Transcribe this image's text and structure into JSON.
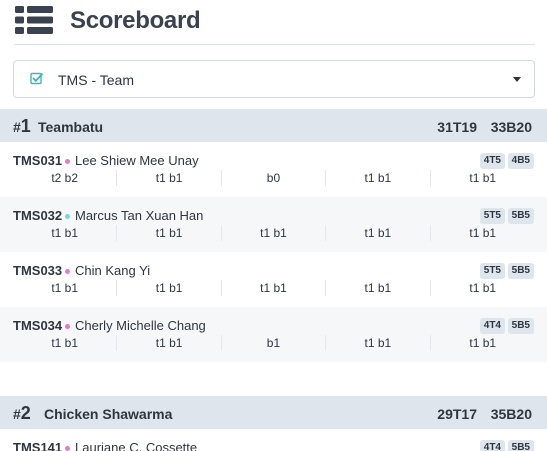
{
  "header": {
    "title": "Scoreboard",
    "menu_icon": "list-icon"
  },
  "selector": {
    "label": "TMS - Team",
    "check_icon": "checkbox-checked-icon",
    "caret_icon": "caret-down-icon"
  },
  "colors": {
    "accent_teal": "#3fb8b0",
    "dot_pink": "#e879c9",
    "dot_teal": "#7fd3d8",
    "team_bg": "#dfe5ec"
  },
  "teams": [
    {
      "hash": "#",
      "rank": "1",
      "name": "Teambatu",
      "score_top": "31T19",
      "score_bonus": "33B20",
      "players": [
        {
          "id": "TMS031",
          "name": "Lee Shiew Mee Unay",
          "badge_top": "4T5",
          "badge_bonus": "4B5",
          "attempts": [
            "t2 b2",
            "t1 b1",
            "b0",
            "t1 b1",
            "t1 b1"
          ]
        },
        {
          "id": "TMS032",
          "name": "Marcus Tan Xuan Han",
          "badge_top": "5T5",
          "badge_bonus": "5B5",
          "attempts": [
            "t1 b1",
            "t1 b1",
            "t1 b1",
            "t1 b1",
            "t1 b1"
          ]
        },
        {
          "id": "TMS033",
          "name": "Chin Kang Yi",
          "badge_top": "5T5",
          "badge_bonus": "5B5",
          "attempts": [
            "t1 b1",
            "t1 b1",
            "t1 b1",
            "t1 b1",
            "t1 b1"
          ]
        },
        {
          "id": "TMS034",
          "name": "Cherly Michelle Chang",
          "badge_top": "4T4",
          "badge_bonus": "5B5",
          "attempts": [
            "t1 b1",
            "t1 b1",
            "b1",
            "t1 b1",
            "t1 b1"
          ]
        }
      ]
    },
    {
      "hash": "#",
      "rank": "2",
      "name": "Chicken Shawarma",
      "score_top": "29T17",
      "score_bonus": "35B20",
      "players": [
        {
          "id": "TMS141",
          "name": "Lauriane C. Cossette",
          "badge_top": "4T4",
          "badge_bonus": "5B5"
        }
      ]
    }
  ]
}
